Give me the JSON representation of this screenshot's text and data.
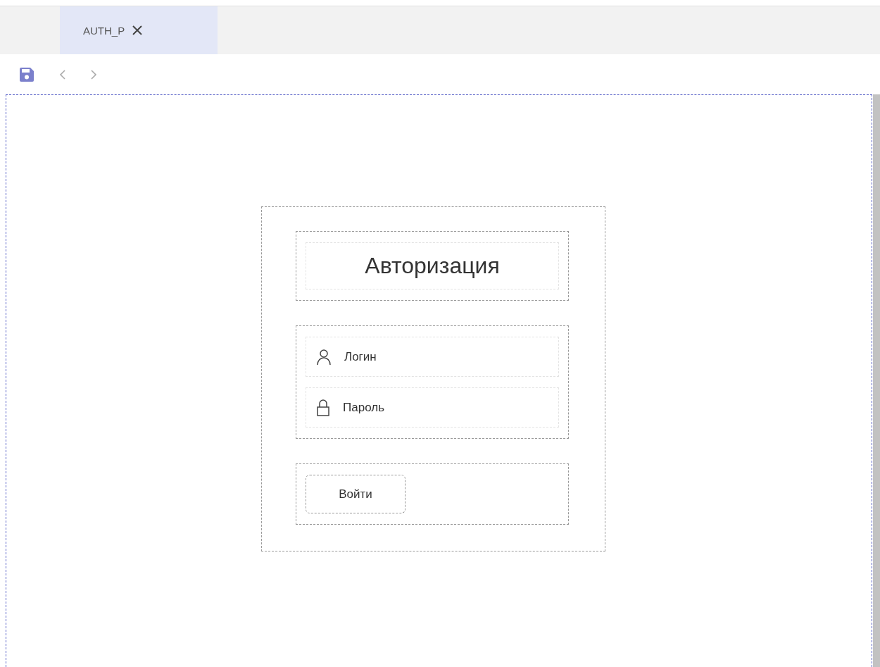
{
  "tabs": [
    {
      "label": "AUTH_P",
      "selected": true
    }
  ],
  "toolbar": {
    "buttons": [
      {
        "kind": "save"
      },
      {
        "kind": "back"
      },
      {
        "kind": "forward"
      }
    ]
  },
  "form": {
    "title": "Авторизация",
    "fields": [
      {
        "kind": "user",
        "placeholder": "Логин"
      },
      {
        "kind": "password",
        "placeholder": "Пароль"
      }
    ],
    "submit": "Войти"
  }
}
